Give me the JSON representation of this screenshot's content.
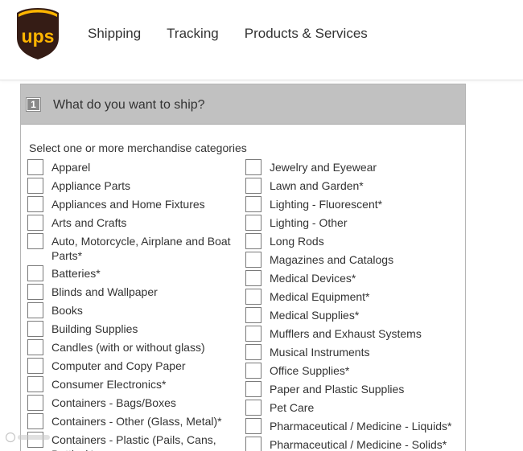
{
  "brand": {
    "logo_text": "ups",
    "colors": {
      "shield": "#351c15",
      "gold": "#ffb500"
    }
  },
  "nav": {
    "items": [
      "Shipping",
      "Tracking",
      "Products & Services"
    ]
  },
  "panel": {
    "step": "1",
    "title": "What do you want to ship?",
    "prompt": "Select one or more merchandise categories",
    "left_items": [
      "Apparel",
      "Appliance Parts",
      "Appliances and Home Fixtures",
      "Arts and Crafts",
      "Auto, Motorcycle, Airplane and Boat Parts*",
      "Batteries*",
      "Blinds and Wallpaper",
      "Books",
      "Building Supplies",
      "Candles (with or without glass)",
      "Computer and Copy Paper",
      "Consumer Electronics*",
      "Containers - Bags/Boxes",
      "Containers - Other (Glass, Metal)*",
      "Containers - Plastic (Pails, Cans, Bottles)*"
    ],
    "right_items": [
      "Jewelry and Eyewear",
      "Lawn and Garden*",
      "Lighting - Fluorescent*",
      "Lighting - Other",
      "Long Rods",
      "Magazines and Catalogs",
      "Medical Devices*",
      "Medical Equipment*",
      "Medical Supplies*",
      "Mufflers and Exhaust Systems",
      "Musical Instruments",
      "Office Supplies*",
      "Paper and Plastic Supplies",
      "Pet Care",
      "Pharmaceutical / Medicine - Liquids*",
      "Pharmaceutical / Medicine - Solids*"
    ]
  }
}
